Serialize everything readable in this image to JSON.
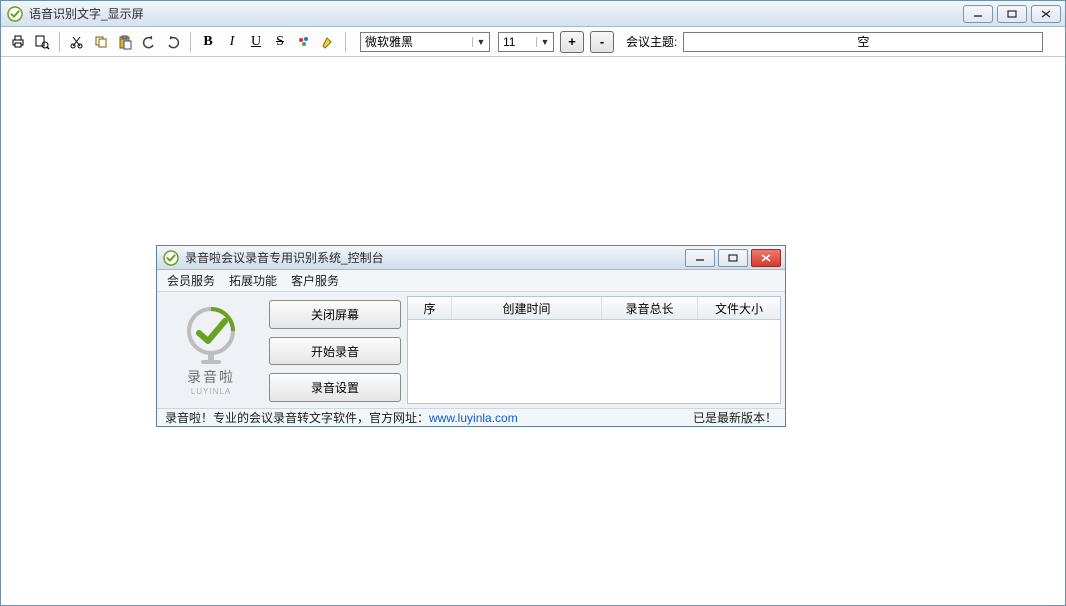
{
  "main_window": {
    "title": "语音识别文字_显示屏"
  },
  "toolbar": {
    "font_name": "微软雅黑",
    "font_size": "11",
    "topic_label": "会议主题:",
    "topic_value": "空",
    "bold_glyph": "B",
    "italic_glyph": "I",
    "underline_glyph": "U",
    "strike_glyph": "S",
    "step_plus": "+",
    "step_minus": "-"
  },
  "dialog": {
    "title": "录音啦会议录音专用识别系统_控制台",
    "menu": [
      "会员服务",
      "拓展功能",
      "客户服务"
    ],
    "logo_text": "录音啦",
    "logo_sub": "LUYINLA",
    "buttons": {
      "close_screen": "关闭屏幕",
      "start_record": "开始录音",
      "record_settings": "录音设置"
    },
    "columns": {
      "seq": "序",
      "create_time": "创建时间",
      "duration": "录音总长",
      "file_size": "文件大小"
    },
    "status_left": "录音啦！专业的会议录音转文字软件，官方网址：",
    "status_url": "www.luyinla.com",
    "status_right": "已是最新版本！"
  }
}
